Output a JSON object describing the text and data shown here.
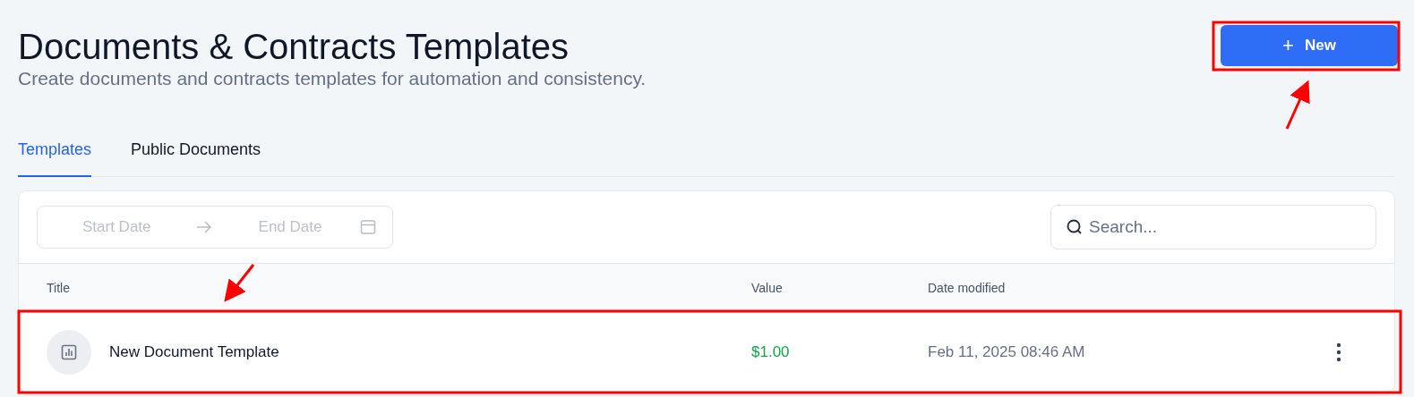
{
  "page": {
    "title": "Documents & Contracts Templates",
    "subtitle": "Create documents and contracts templates for automation and consistency."
  },
  "new_button": {
    "icon": "+",
    "label": "New"
  },
  "tabs": [
    {
      "label": "Templates",
      "selected": true
    },
    {
      "label": "Public Documents",
      "selected": false
    }
  ],
  "date_range": {
    "start_placeholder": "Start Date",
    "end_placeholder": "End Date"
  },
  "search": {
    "placeholder": "Search..."
  },
  "table": {
    "columns": [
      "Title",
      "Value",
      "Date modified"
    ],
    "rows": [
      {
        "title": "New Document Template",
        "value": "$1.00",
        "date_modified": "Feb 11, 2025 08:46 AM"
      }
    ]
  }
}
